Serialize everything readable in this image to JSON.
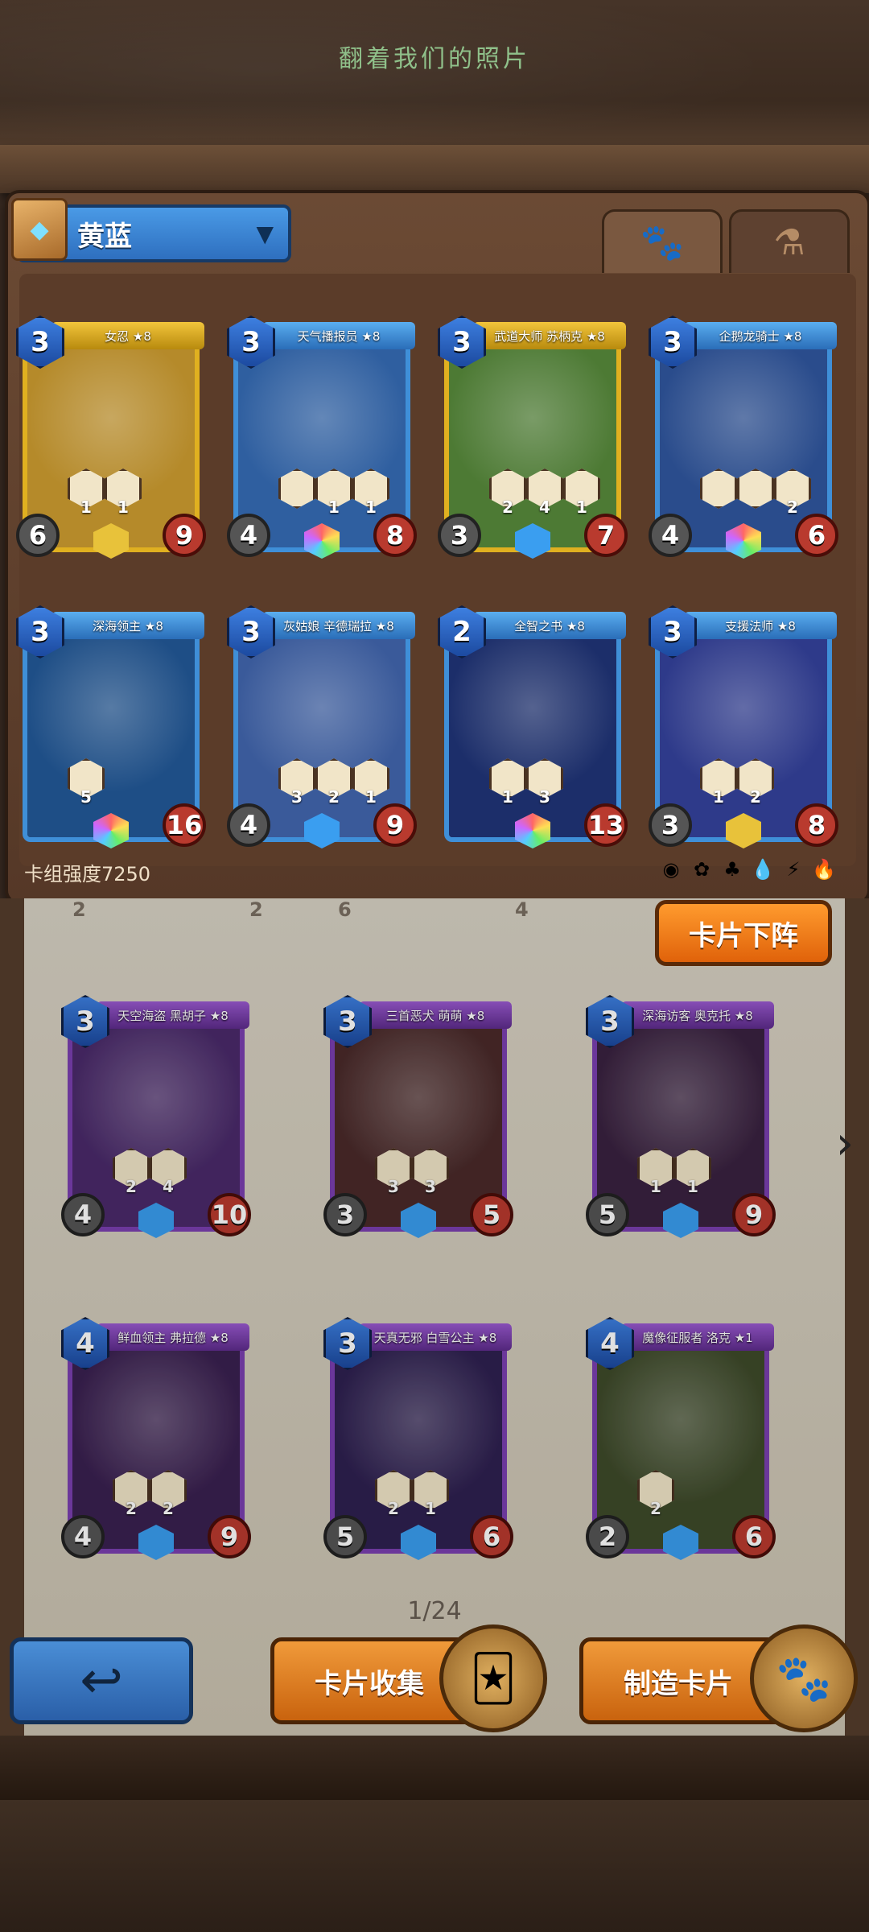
{
  "header": {
    "subtitle": "翻着我们的照片"
  },
  "deck": {
    "name": "黄蓝",
    "tabs": [
      {
        "icon": "paw-icon",
        "active": true
      },
      {
        "icon": "potion-icon",
        "active": false
      }
    ],
    "strength_label": "卡组强度7250",
    "filters": [
      "◉",
      "✿",
      "♣",
      "💧",
      "⚡",
      "🔥"
    ],
    "cards": [
      {
        "title": "女忍 ★8",
        "cost": "3",
        "atk": "6",
        "hp": "9",
        "skills": [
          "1",
          "1"
        ],
        "frame": "gold",
        "gem": "yellow",
        "art": "#b58a2a"
      },
      {
        "title": "天气播报员 ★8",
        "cost": "3",
        "atk": "4",
        "hp": "8",
        "skills": [
          "",
          "1",
          "1"
        ],
        "frame": "blue",
        "gem": "rainbow",
        "art": "#2f5fa0"
      },
      {
        "title": "武道大师 苏柄克 ★8",
        "cost": "3",
        "atk": "3",
        "hp": "7",
        "skills": [
          "2",
          "4",
          "1"
        ],
        "frame": "gold",
        "gem": "blue",
        "art": "#4d7a34"
      },
      {
        "title": "企鹅龙骑士 ★8",
        "cost": "3",
        "atk": "4",
        "hp": "6",
        "skills": [
          "",
          "",
          "2"
        ],
        "frame": "blue",
        "gem": "rainbow",
        "art": "#2a4c8c"
      },
      {
        "title": "深海领主 ★8",
        "cost": "3",
        "atk": "",
        "hp": "16",
        "skills": [
          "5"
        ],
        "frame": "blue",
        "gem": "rainbow",
        "art": "#1e4e86"
      },
      {
        "title": "灰姑娘 辛德瑞拉 ★8",
        "cost": "3",
        "atk": "4",
        "hp": "9",
        "skills": [
          "3",
          "2",
          "1"
        ],
        "frame": "blue",
        "gem": "blue",
        "art": "#3a5a9a"
      },
      {
        "title": "全智之书 ★8",
        "cost": "2",
        "atk": "",
        "hp": "13",
        "skills": [
          "1",
          "3"
        ],
        "frame": "blue",
        "gem": "rainbow",
        "art": "#1c2e6a"
      },
      {
        "title": "支援法师 ★8",
        "cost": "3",
        "atk": "3",
        "hp": "8",
        "skills": [
          "1",
          "2"
        ],
        "frame": "blue",
        "gem": "yellow",
        "art": "#2e3a8a"
      }
    ]
  },
  "collection": {
    "partial_row": [
      "2",
      "2",
      "6",
      "4"
    ],
    "remove_button": "卡片下阵",
    "page": "1/24",
    "cards": [
      {
        "title": "天空海盗 黑胡子 ★8",
        "cost": "3",
        "atk": "4",
        "hp": "10",
        "skills": [
          "2",
          "4"
        ],
        "art": "#4a2a6a"
      },
      {
        "title": "三首恶犬 萌萌 ★8",
        "cost": "3",
        "atk": "3",
        "hp": "5",
        "skills": [
          "3",
          "3"
        ],
        "art": "#4a2a2a"
      },
      {
        "title": "深海访客 奥克托 ★8",
        "cost": "3",
        "atk": "5",
        "hp": "9",
        "skills": [
          "1",
          "1"
        ],
        "art": "#3a2240"
      },
      {
        "title": "鲜血领主 弗拉德 ★8",
        "cost": "4",
        "atk": "4",
        "hp": "9",
        "skills": [
          "2",
          "2"
        ],
        "art": "#3a2050"
      },
      {
        "title": "天真无邪 白雪公主 ★8",
        "cost": "3",
        "atk": "5",
        "hp": "6",
        "skills": [
          "2",
          "1"
        ],
        "art": "#2e2050"
      },
      {
        "title": "魔像征服者 洛克 ★1",
        "cost": "4",
        "atk": "2",
        "hp": "6",
        "skills": [
          "2"
        ],
        "art": "#3e4a2a"
      }
    ]
  },
  "bottom": {
    "back_icon": "back-arrow-icon",
    "collection_label": "卡片收集",
    "craft_label": "制造卡片"
  }
}
